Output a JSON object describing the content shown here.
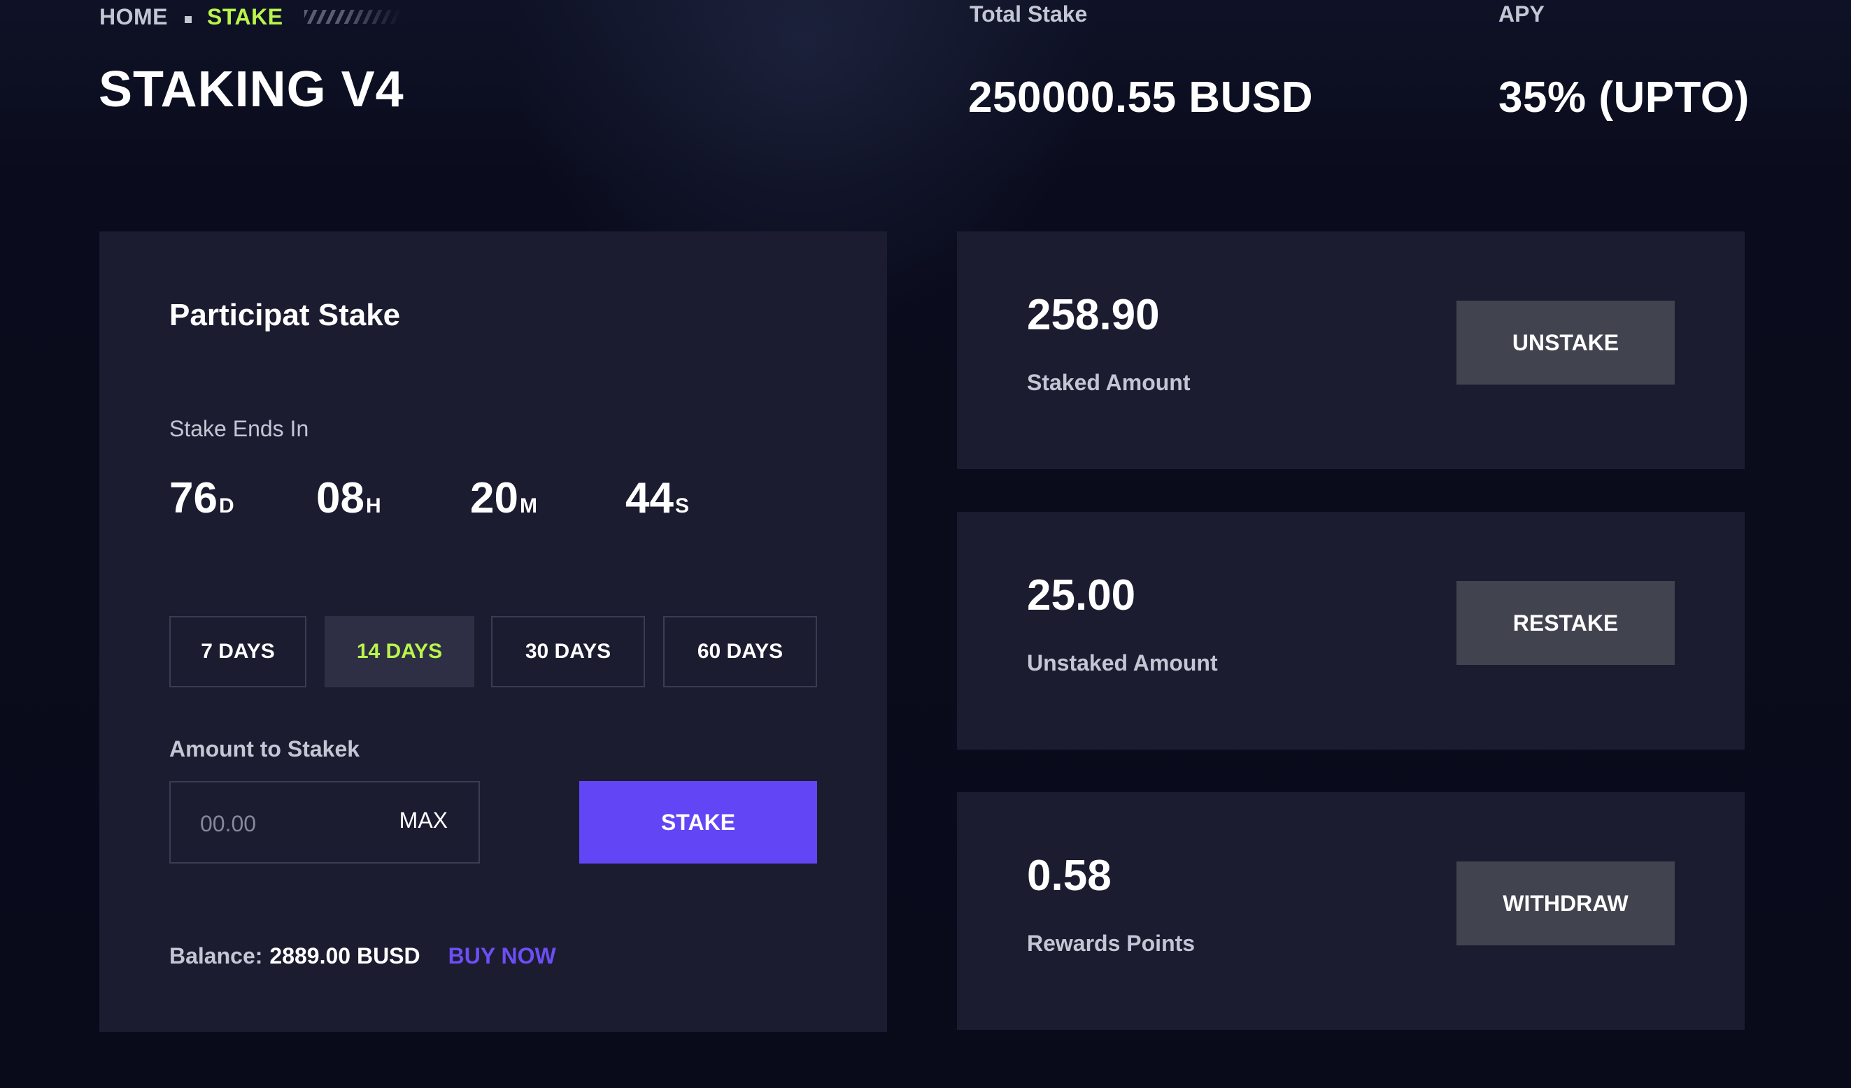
{
  "breadcrumb": {
    "home": "HOME",
    "current": "STAKE"
  },
  "page_title": "STAKING V4",
  "stats": {
    "total_stake_label": "Total Stake",
    "total_stake_value": "250000.55 BUSD",
    "apy_label": "APY",
    "apy_value": "35% (UPTO)"
  },
  "stake_card": {
    "title": "Participat Stake",
    "ends_label": "Stake Ends In",
    "timer": [
      {
        "value": "76",
        "unit": "D"
      },
      {
        "value": "08",
        "unit": "H"
      },
      {
        "value": "20",
        "unit": "M"
      },
      {
        "value": "44",
        "unit": "S"
      }
    ],
    "periods": [
      {
        "label": "7 DAYS",
        "active": false
      },
      {
        "label": "14 DAYS",
        "active": true
      },
      {
        "label": "30 DAYS",
        "active": false
      },
      {
        "label": "60 DAYS",
        "active": false
      }
    ],
    "amount_label": "Amount to Stakek",
    "amount_placeholder": "00.00",
    "amount_value": "",
    "max_label": "MAX",
    "stake_button": "STAKE",
    "balance_label": "Balance:",
    "balance_value": "2889.00 BUSD",
    "buy_now": "BUY NOW"
  },
  "info_cards": [
    {
      "value": "258.90",
      "label": "Staked Amount",
      "action": "UNSTAKE"
    },
    {
      "value": "25.00",
      "label": "Unstaked Amount",
      "action": "RESTAKE"
    },
    {
      "value": "0.58",
      "label": "Rewards Points",
      "action": "WITHDRAW"
    }
  ],
  "colors": {
    "background": "#0a0c1d",
    "card": "#1b1c30",
    "accent_green": "#b9f54a",
    "accent_purple": "#6246f5",
    "secondary_button": "#41434f",
    "muted_text": "#c4c6d4"
  }
}
